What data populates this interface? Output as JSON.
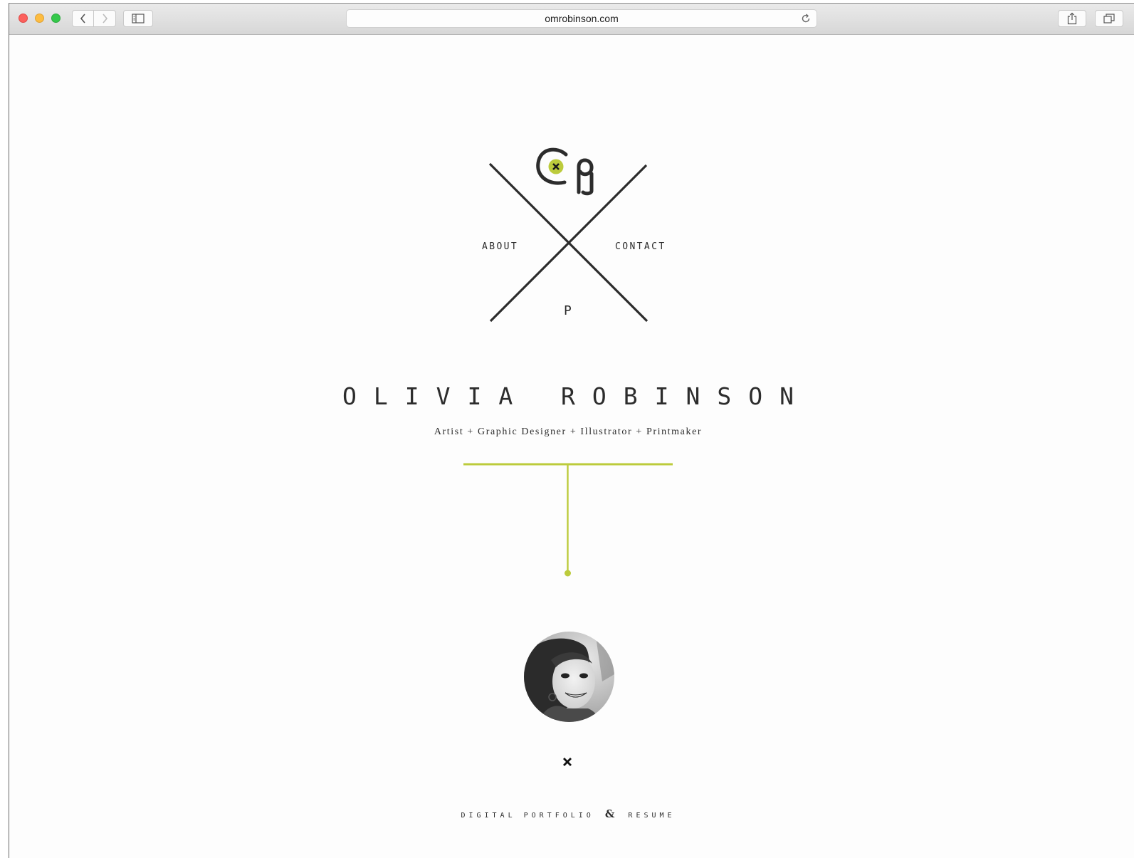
{
  "browser": {
    "url": "omrobinson.com"
  },
  "nav": {
    "about": "ABOUT",
    "contact": "CONTACT",
    "portfolio": "P"
  },
  "hero": {
    "name": "OLIVIA ROBINSON",
    "tagline": "Artist + Graphic Designer + Illustrator + Printmaker"
  },
  "footer": {
    "left": "DIGITAL PORTFOLIO",
    "amp": "&",
    "right": "RESUME"
  },
  "colors": {
    "accent": "#bccb3c",
    "ink": "#2c2c2c"
  }
}
